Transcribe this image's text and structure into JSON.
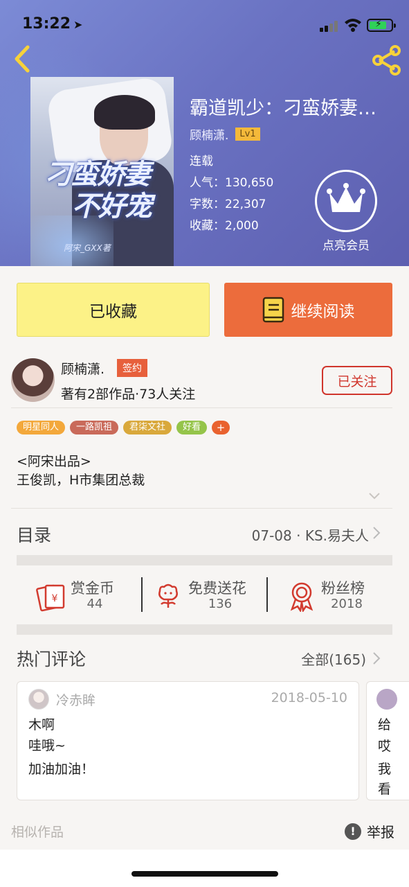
{
  "status_bar": {
    "time": "13:22",
    "location_arrow": "➤"
  },
  "book": {
    "title": "霸道凯少：刁蛮娇妻…",
    "author": "顾楠潇.",
    "level": "Lv1",
    "status": "连载",
    "popularity_label": "人气：",
    "popularity": "130,650",
    "words_label": "字数：",
    "words": "22,307",
    "favorites_label": "收藏：",
    "favorites": "2,000",
    "cover_title_line1": "刁蛮娇妻",
    "cover_title_line2": "不好宠",
    "cover_sub": "阿宋_GXX著"
  },
  "vip": {
    "label": "点亮会员"
  },
  "actions": {
    "favorited_label": "已收藏",
    "continue_label": "继续阅读"
  },
  "author_card": {
    "name": "顾楠潇.",
    "badge": "签约",
    "stats": "著有2部作品·73人关注",
    "follow_label": "已关注"
  },
  "tags": [
    {
      "label": "明星同人",
      "color": "#f3a83b"
    },
    {
      "label": "一路凯祖",
      "color": "#c96a5a"
    },
    {
      "label": "君柒文社",
      "color": "#d9a83b"
    },
    {
      "label": "好看",
      "color": "#95c44a"
    }
  ],
  "tag_more": "+",
  "description": {
    "line1": "<阿宋出品>",
    "line2": "王俊凯，H市集团总裁"
  },
  "toc": {
    "label": "目录",
    "latest": "07-08 · KS.易夫人"
  },
  "stats": [
    {
      "label": "赏金币",
      "value": "44",
      "icon": "red-envelope-icon"
    },
    {
      "label": "免费送花",
      "value": "136",
      "icon": "flower-icon"
    },
    {
      "label": "粉丝榜",
      "value": "2018",
      "icon": "medal-icon"
    }
  ],
  "comments": {
    "label": "热门评论",
    "all_label": "全部(165)",
    "items": [
      {
        "user": "冷赤眸",
        "date": "2018-05-10",
        "lines": [
          "木啊",
          "哇哦~",
          "加油加油！"
        ]
      }
    ],
    "peek": {
      "lines": [
        "给",
        "哎",
        "我",
        "看"
      ]
    }
  },
  "footer": {
    "similar_label": "相似作品",
    "report_label": "举报",
    "report_icon": "!"
  },
  "colors": {
    "accent_orange": "#ec6c3c",
    "fav_yellow": "#fcf287",
    "follow_red": "#d0352c",
    "vip_gold": "#f4b93a"
  }
}
